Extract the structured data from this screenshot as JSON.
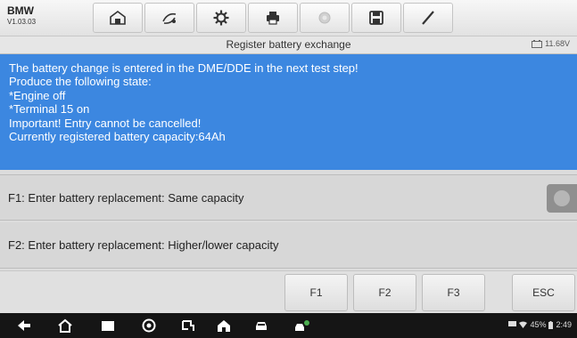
{
  "brand": {
    "name": "BMW",
    "version": "V1.03.03"
  },
  "toolbar": {
    "icons": [
      "home-icon",
      "vehicle-swap-icon",
      "gear-icon",
      "printer-icon",
      "help-icon",
      "save-icon",
      "edit-icon"
    ]
  },
  "titlebar": {
    "title": "Register battery exchange",
    "voltage": "11.68V"
  },
  "message": {
    "lines": [
      "The battery change is entered in the DME/DDE in the next test step!",
      "Produce the following state:",
      "*Engine off",
      "*Terminal 15 on",
      "Important! Entry cannot be cancelled!",
      "Currently registered battery capacity:64Ah"
    ]
  },
  "options": [
    {
      "label": "F1: Enter battery replacement: Same capacity"
    },
    {
      "label": "F2: Enter battery replacement: Higher/lower capacity"
    }
  ],
  "function_buttons": {
    "f1": "F1",
    "f2": "F2",
    "f3": "F3",
    "esc": "ESC"
  },
  "statusbar": {
    "battery": "45%",
    "time": "2:49"
  },
  "colors": {
    "message_bg": "#3c87e0",
    "options_bg": "#d7d7d7",
    "nav_bg": "#151515"
  }
}
